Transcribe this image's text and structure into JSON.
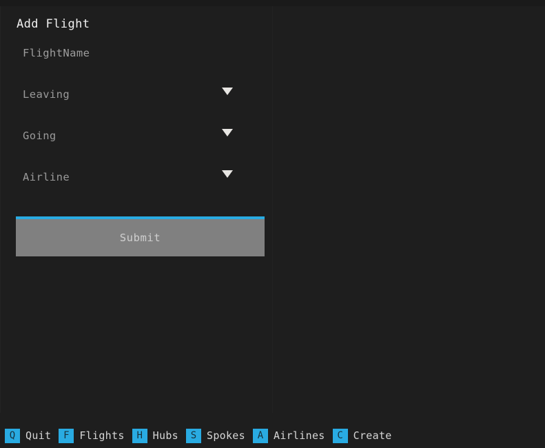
{
  "theme": {
    "background": "#1e1e1e",
    "accent": "#29abe2",
    "panel_border": "#242424",
    "button_face": "#808080",
    "title_color": "#f0f0f0",
    "placeholder_color": "#9a9a9a",
    "status_key_bg": "#29abe2",
    "status_key_fg": "#17303c",
    "status_label_fg": "#d6d6d6",
    "chevron_color": "#e8e6e3"
  },
  "form": {
    "title": "Add Flight",
    "fields": [
      {
        "name": "flight-name",
        "kind": "text",
        "label": "FlightName",
        "placeholder": "FlightName",
        "value": ""
      },
      {
        "name": "leaving",
        "kind": "select",
        "label": "Leaving",
        "placeholder": "Leaving",
        "value": "",
        "chevron": "chevron-down-icon"
      },
      {
        "name": "going",
        "kind": "select",
        "label": "Going",
        "placeholder": "Going",
        "value": "",
        "chevron": "chevron-down-icon"
      },
      {
        "name": "airline",
        "kind": "select",
        "label": "Airline",
        "placeholder": "Airline",
        "value": "",
        "chevron": "chevron-down-icon"
      }
    ],
    "submit": {
      "label": "Submit"
    }
  },
  "statusbar": {
    "items": [
      {
        "key": "Q",
        "label": "Quit"
      },
      {
        "key": "F",
        "label": "Flights"
      },
      {
        "key": "H",
        "label": "Hubs"
      },
      {
        "key": "S",
        "label": "Spokes"
      },
      {
        "key": "A",
        "label": "Airlines"
      },
      {
        "key": "C",
        "label": "Create"
      }
    ]
  }
}
